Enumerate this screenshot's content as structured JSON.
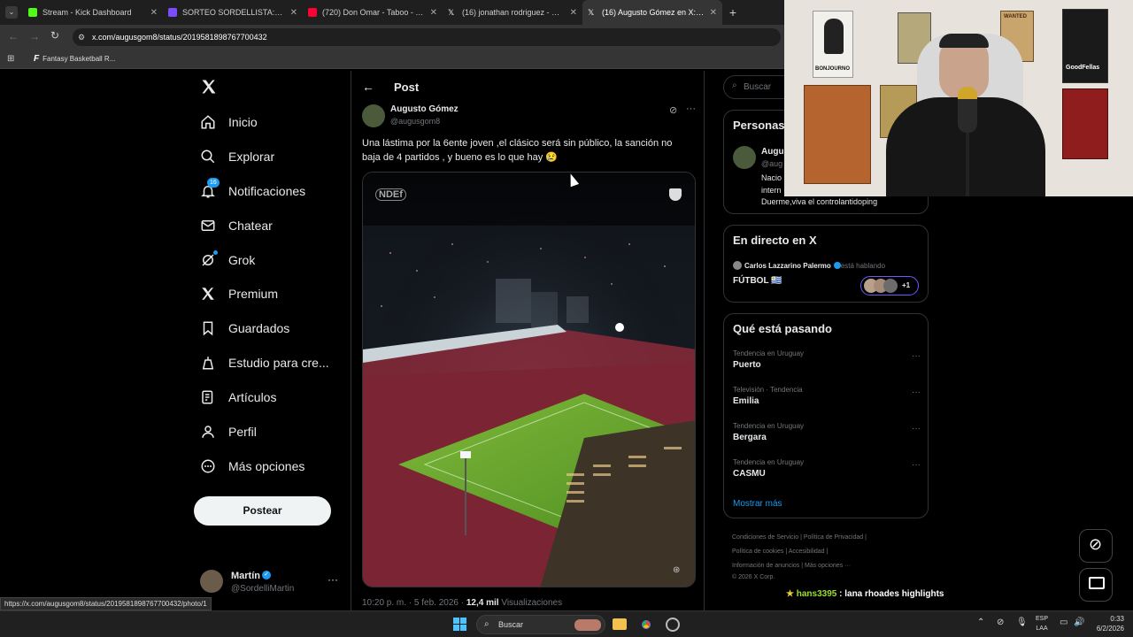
{
  "browser": {
    "tabs": [
      {
        "title": "Stream - Kick Dashboard",
        "color": "#53fc18"
      },
      {
        "title": "SORTEO SORDELLISTA: CAMISE",
        "color": "#7c4dff"
      },
      {
        "title": "(720) Don Omar - Taboo - YouT",
        "color": "#ff0033"
      },
      {
        "title": "(16) jonathan rodriguez - Busca",
        "color": "#ffffff"
      },
      {
        "title": "(16) Augusto Gómez en X: \"Una",
        "color": "#ffffff"
      }
    ],
    "url": "x.com/augusgom8/status/2019581898767700432",
    "bookmark": "Fantasy Basketball R...",
    "status_url": "https://x.com/augusgom8/status/2019581898767700432/photo/1"
  },
  "nav": {
    "items": [
      {
        "label": "Inicio",
        "icon": "home-icon"
      },
      {
        "label": "Explorar",
        "icon": "search-icon"
      },
      {
        "label": "Notificaciones",
        "icon": "bell-icon",
        "badge": "16"
      },
      {
        "label": "Chatear",
        "icon": "mail-icon"
      },
      {
        "label": "Grok",
        "icon": "grok-icon"
      },
      {
        "label": "Premium",
        "icon": "x-icon"
      },
      {
        "label": "Guardados",
        "icon": "bookmark-icon"
      },
      {
        "label": "Estudio para cre...",
        "icon": "studio-icon"
      },
      {
        "label": "Artículos",
        "icon": "article-icon"
      },
      {
        "label": "Perfil",
        "icon": "person-icon"
      },
      {
        "label": "Más opciones",
        "icon": "more-circle-icon"
      }
    ],
    "post_button": "Postear",
    "account": {
      "name": "Martín",
      "handle": "@SordelliMartin"
    }
  },
  "post": {
    "header": "Post",
    "author": "Augusto Gómez",
    "handle": "@augusgom8",
    "text_line1": "Una lástima por la 6ente joven ,el clásico será sin público,  la sanción no",
    "text_line2": "baja de 4 partidos , y bueno es lo que hay 😢",
    "image_watermark": "NDEf",
    "timestamp": "10:20 p. m. · 5 feb. 2026 · ",
    "views_count": "12,4 mil",
    "views_label": " Visualizaciones"
  },
  "right": {
    "search_placeholder": "Buscar",
    "people_title": "Personas",
    "person_name": "Augu",
    "person_handle": "@aug",
    "person_bio1": "Nacio",
    "person_bio2": "intern",
    "person_bio3": "Duerme,viva el controlantidoping",
    "live_title": "En directo en X",
    "live_host": "Carlos Lazzarino Palermo",
    "live_status": " está hablando",
    "live_topic": "FÚTBOL 🇺🇾",
    "live_more": "+1",
    "trends_title": "Qué está pasando",
    "trends": [
      {
        "meta": "Tendencia en Uruguay",
        "name": "Puerto"
      },
      {
        "meta": "Televisión · Tendencia",
        "name": "Emilia"
      },
      {
        "meta": "Tendencia en Uruguay",
        "name": "Bergara"
      },
      {
        "meta": "Tendencia en Uruguay",
        "name": "CASMU"
      }
    ],
    "show_more": "Mostrar más",
    "footer_links": [
      "Condiciones de Servicio",
      "Política de Privacidad",
      "Política de cookies",
      "Accesibilidad",
      "Información de anuncios",
      "Más opciones ···",
      "© 2026 X Corp."
    ]
  },
  "overlay": {
    "chat_user": "hans3395",
    "chat_msg": " : lana rhoades highlights",
    "posters": [
      "BONJOURNO",
      "WANTED",
      "GoodFellas"
    ]
  },
  "taskbar": {
    "search": "Buscar",
    "lang1": "ESP",
    "lang2": "LAA",
    "time": "0:33",
    "date": "6/2/2026"
  }
}
